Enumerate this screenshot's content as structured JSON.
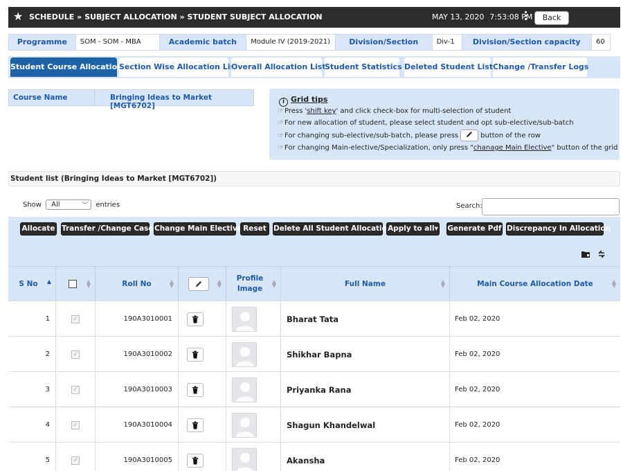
{
  "header": {
    "breadcrumb": "SCHEDULE » SUBJECT ALLOCATION » STUDENT SUBJECT ALLOCATION",
    "date": "MAY 13, 2020",
    "time": "7:53:08 PM",
    "back_label": "Back"
  },
  "info": {
    "programme_label": "Programme",
    "programme_value": "SOM - SOM - MBA",
    "batch_label": "Academic batch",
    "batch_value": "Module IV (2019-2021)",
    "division_label": "Division/Section",
    "division_value": "Div-1",
    "capacity_label": "Division/Section capacity",
    "capacity_value": "60"
  },
  "tabs": [
    {
      "label": "Student Course Allocation",
      "active": true
    },
    {
      "label": "Section Wise Allocation List"
    },
    {
      "label": "Overall Allocation List"
    },
    {
      "label": "Student Statistics"
    },
    {
      "label": "Deleted Student List"
    },
    {
      "label": "Change /Transfer Logs"
    }
  ],
  "course": {
    "label": "Course Name",
    "value": "Bringing Ideas to Market [MGT6702]"
  },
  "tips": {
    "title": "Grid tips",
    "l1_a": "Press '",
    "l1_link": "shift key",
    "l1_b": "' and click check-box for multi-selection of student",
    "l2": "For new allocation of student, please select student and opt sub-elective/sub-batch",
    "l3_a": "For changing sub-elective/sub-batch, please press",
    "l3_b": "button of the row",
    "l4_a": "For changing Main-elective/Specialization, only press \"",
    "l4_link": "chanage Main Elective",
    "l4_b": "\" button of the grid"
  },
  "student_list_title": "Student list (Bringing Ideas to Market [MGT6702])",
  "show": {
    "label": "Show",
    "value": "All",
    "suffix": "entries"
  },
  "search_label": "Search:",
  "toolbar": {
    "allocate": "Allocate",
    "transfer": "Transfer /Change Case",
    "change_main": "Change Main Elective",
    "reset": "Reset",
    "delete_all": "Delete All Student Allocation",
    "apply_all": "Apply to all▾",
    "generate_pdf": "Generate Pdf",
    "discrepancy": "Discrepancy In Allocation"
  },
  "columns": {
    "sno": "S No",
    "roll": "Roll No",
    "profile_1": "Profile",
    "profile_2": "Image",
    "name": "Full Name",
    "date": "Main Course Allocation Date"
  },
  "rows": [
    {
      "sno": "1",
      "roll": "190A3010001",
      "name": "Bharat Tata",
      "date": "Feb 02, 2020"
    },
    {
      "sno": "2",
      "roll": "190A3010002",
      "name": "Shikhar Bapna",
      "date": "Feb 02, 2020"
    },
    {
      "sno": "3",
      "roll": "190A3010003",
      "name": "Priyanka Rana",
      "date": "Feb 02, 2020"
    },
    {
      "sno": "4",
      "roll": "190A3010004",
      "name": "Shagun Khandelwal",
      "date": "Feb 02, 2020"
    },
    {
      "sno": "5",
      "roll": "190A3010005",
      "name": "Akansha",
      "date": "Feb 02, 2020"
    }
  ]
}
